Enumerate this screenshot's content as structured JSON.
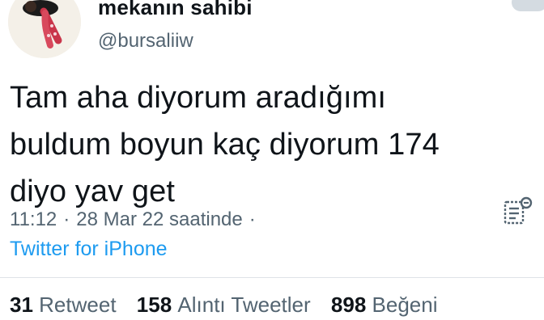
{
  "user": {
    "display_name": "mekanın sahibi",
    "handle": "@bursaliiw"
  },
  "tweet": {
    "text": "Tam aha diyorum aradığımı\nbuldum boyun kaç diyorum 174\ndiyo yav get",
    "time": "11:12",
    "date_text": "28 Mar 22 saatinde",
    "separator": "·",
    "source": "Twitter for iPhone"
  },
  "stats": {
    "retweets_count": "31",
    "retweets_label": "Retweet",
    "quotes_count": "158",
    "quotes_label": "Alıntı Tweetler",
    "likes_count": "898",
    "likes_label": "Beğeni"
  },
  "icons": {
    "analytics": "analytics-icon"
  },
  "colors": {
    "text": "#0f1419",
    "secondary": "#536471",
    "link": "#1d9bf0"
  }
}
